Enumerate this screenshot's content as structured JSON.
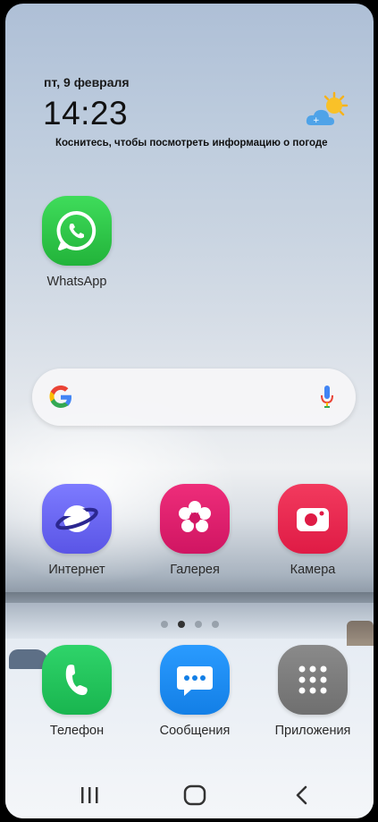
{
  "status": {
    "date": "пт, 9 февраля",
    "time": "14:23",
    "weather_hint": "Коснитесь, чтобы посмотреть информацию о погоде",
    "weather_icon": "partly-cloudy-sun-icon"
  },
  "apps_top": [
    {
      "label": "WhatsApp",
      "icon": "whatsapp-icon",
      "color": "#2ecc40"
    }
  ],
  "search": {
    "icon": "google-icon",
    "mic_icon": "microphone-icon"
  },
  "apps_row": [
    {
      "label": "Интернет",
      "icon": "internet-planet-icon",
      "color": "#6c63ff"
    },
    {
      "label": "Галерея",
      "icon": "gallery-flower-icon",
      "color": "#e0206e"
    },
    {
      "label": "Камера",
      "icon": "camera-icon",
      "color": "#ea2550"
    }
  ],
  "dock": [
    {
      "label": "Телефон",
      "icon": "phone-icon",
      "color": "#20c35a"
    },
    {
      "label": "Сообщения",
      "icon": "messages-icon",
      "color": "#1e8cf0"
    },
    {
      "label": "Приложения",
      "icon": "apps-grid-icon",
      "color": "#7a7a7a"
    }
  ],
  "page_indicator": {
    "count": 4,
    "active_index": 1
  },
  "navbar": {
    "recents_icon": "recents-icon",
    "home_icon": "home-icon",
    "back_icon": "back-icon"
  }
}
